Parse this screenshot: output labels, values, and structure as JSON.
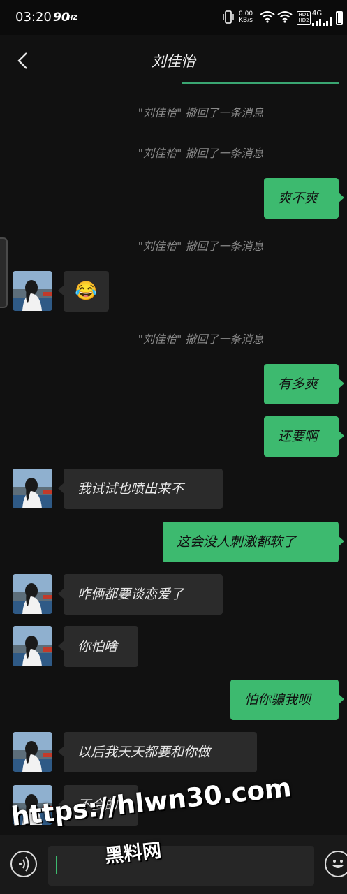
{
  "status_bar": {
    "time": "03:20",
    "refresh_rate": "90",
    "refresh_unit": "HZ",
    "net_speed_value": "0.00",
    "net_speed_unit": "KB/s",
    "hd_badges": [
      "HD1",
      "HD2"
    ],
    "network_labels": [
      "4G",
      "4G"
    ]
  },
  "header": {
    "title": "刘佳怡"
  },
  "messages": [
    {
      "kind": "system",
      "text": "\"刘佳怡\" 撤回了一条消息"
    },
    {
      "kind": "system",
      "text": "\"刘佳怡\" 撤回了一条消息"
    },
    {
      "kind": "outgoing",
      "text": "爽不爽"
    },
    {
      "kind": "system",
      "text": "\"刘佳怡\" 撤回了一条消息"
    },
    {
      "kind": "incoming",
      "text": "😂"
    },
    {
      "kind": "system",
      "text": "\"刘佳怡\" 撤回了一条消息"
    },
    {
      "kind": "outgoing",
      "text": "有多爽"
    },
    {
      "kind": "outgoing",
      "text": "还要啊"
    },
    {
      "kind": "incoming",
      "text": "我试试也喷出来不"
    },
    {
      "kind": "outgoing",
      "text": "这会没人刺激都软了"
    },
    {
      "kind": "incoming",
      "text": "咋俩都要谈恋爱了"
    },
    {
      "kind": "incoming",
      "text": "你怕啥"
    },
    {
      "kind": "outgoing",
      "text": "怕你骗我呗"
    },
    {
      "kind": "incoming",
      "text": "以后我天天都要和你做"
    },
    {
      "kind": "incoming",
      "text": "不会的"
    }
  ],
  "watermark": {
    "url": "https://hlwn30.com",
    "name": "黑料网"
  },
  "colors": {
    "outgoing_bubble": "#3dba6f",
    "incoming_bubble": "#2b2b2b",
    "background": "#111111",
    "accent": "#3aa672"
  }
}
